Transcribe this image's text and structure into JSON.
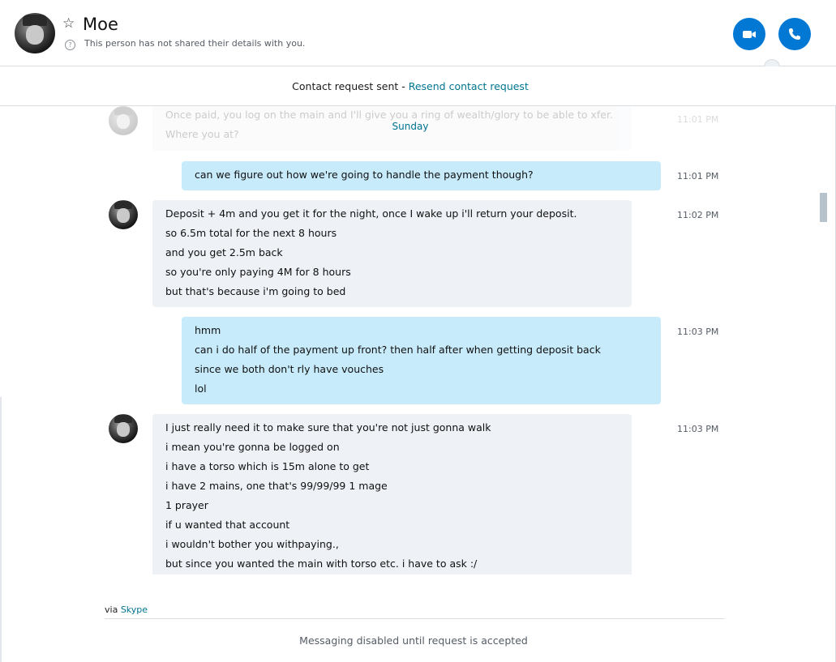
{
  "header": {
    "contact_name": "Moe",
    "details_note": "This person has not shared their details with you.",
    "video_icon": "video-camera-icon",
    "call_icon": "phone-icon",
    "favorite_icon": "star-outline-icon",
    "accent": "#0078d4"
  },
  "request_banner": {
    "status_text": "Contact request sent - ",
    "resend_label": "Resend contact request"
  },
  "conversation": {
    "day_divider": "Sunday",
    "faded_message": {
      "lines": [
        "Once paid, you log on the main and I'll give you a ring of wealth/glory to be able to xfer.",
        "Where you at?"
      ],
      "time": "11:01 PM"
    },
    "messages": [
      {
        "direction": "out",
        "time": "11:01 PM",
        "lines": [
          "can we figure out how we're going to handle the payment though?"
        ]
      },
      {
        "direction": "in",
        "time": "11:02 PM",
        "lines": [
          "Deposit + 4m and you get it for the night, once I wake up i'll return your deposit.",
          "so 6.5m total for the next 8 hours",
          "and you get 2.5m back",
          "so you're only paying 4M for 8 hours",
          "but that's because i'm going to bed"
        ]
      },
      {
        "direction": "out",
        "time": "11:03 PM",
        "lines": [
          "hmm",
          "can i do half of the payment up front? then half after when getting deposit back",
          "since we both don't rly have vouches",
          "lol"
        ]
      },
      {
        "direction": "in",
        "time": "11:03 PM",
        "lines": [
          "I just really need it to make sure that you're not just gonna walk",
          "i mean you're gonna be logged on",
          "i have a torso which is 15m alone to get",
          "i have 2 mains, one that's 99/99/99 1 mage",
          "1 prayer",
          "if u wanted that account",
          "i wouldn't bother you withpaying.,",
          "but since you wanted the main with torso etc. i have to ask :/"
        ]
      }
    ]
  },
  "footer": {
    "via_prefix": "via ",
    "via_link": "Skype",
    "disabled_note": "Messaging disabled until request is accepted"
  }
}
